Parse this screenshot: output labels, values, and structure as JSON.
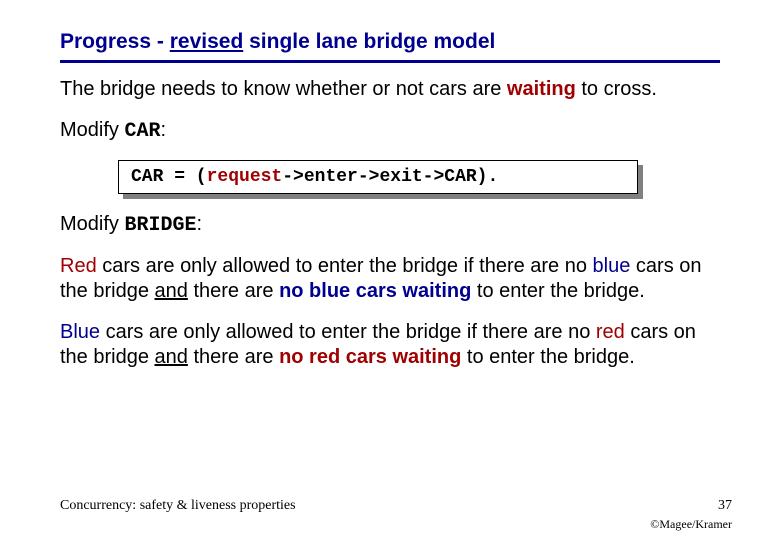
{
  "title_pre": "Progress - ",
  "title_u": "revised",
  "title_post": " single lane bridge model",
  "p1_a": "The bridge needs to know whether or not cars are ",
  "p1_b": "waiting",
  "p1_c": " to cross.",
  "mod_car_a": "Modify ",
  "mod_car_b": "CAR",
  "mod_car_c": ":",
  "code_a": "CAR = (",
  "code_req": "request",
  "code_b": "->enter->exit->CAR).",
  "mod_br_a": "Modify ",
  "mod_br_b": "BRIDGE",
  "mod_br_c": ":",
  "r1": "Red",
  "r2": " cars are only allowed to enter the bridge if there are no ",
  "r3": "blue",
  "r4": " cars on the bridge ",
  "r5": "and",
  "r6": " there are ",
  "r7": "no blue cars waiting",
  "r8": " to enter the bridge.",
  "b1": "Blue",
  "b2": " cars are only allowed to enter the bridge if there are no ",
  "b3": "red",
  "b4": " cars on the bridge ",
  "b5": "and",
  "b6": " there are ",
  "b7": "no red cars waiting",
  "b8": " to enter the bridge.",
  "foot_left": "Concurrency: safety & liveness properties",
  "foot_right": "37",
  "copyright": "©Magee/Kramer"
}
